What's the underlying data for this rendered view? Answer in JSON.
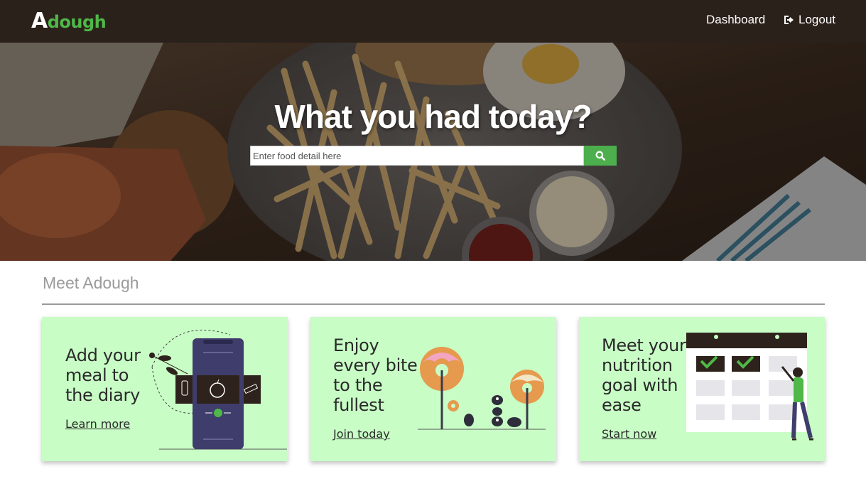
{
  "nav": {
    "logo_first": "A",
    "logo_rest": "dough",
    "dashboard_label": "Dashboard",
    "logout_label": "Logout"
  },
  "hero": {
    "title": "What you had today?",
    "search_placeholder": "Enter food detail here"
  },
  "meet": {
    "title": "Meet Adough"
  },
  "cards": [
    {
      "title": "Add your meal to the diary",
      "link": "Learn more"
    },
    {
      "title": "Enjoy every bite to the fullest",
      "link": "Join today"
    },
    {
      "title": "Meet your nutrition goal with ease",
      "link": "Start now"
    }
  ],
  "colors": {
    "navbar": "#2b211b",
    "brand_green": "#4fb848",
    "card_bg": "#c8fdc6",
    "button_green": "#4cae4c"
  }
}
